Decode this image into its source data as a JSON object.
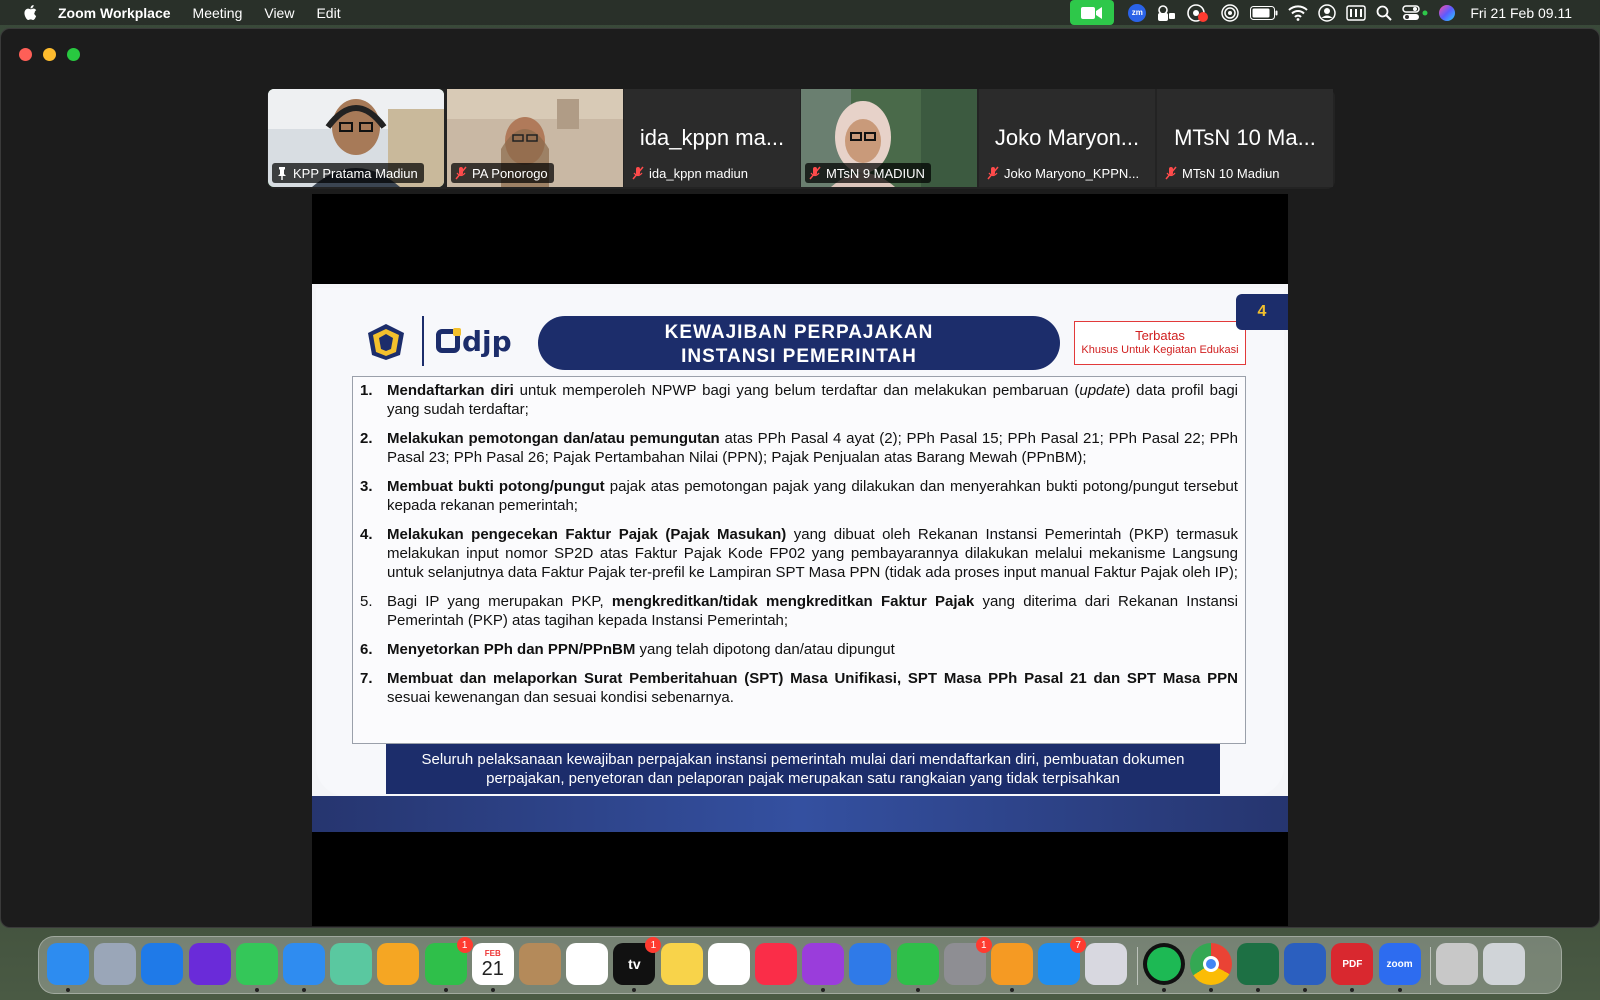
{
  "menubar": {
    "app_name": "Zoom Workplace",
    "menus": [
      "Meeting",
      "View",
      "Edit"
    ],
    "status_icons": [
      "zoom-video-icon",
      "zm-icon",
      "lock-status-icon",
      "screen-record-icon",
      "airplay-icon",
      "battery-icon",
      "wifi-icon",
      "user-icon",
      "keyboard-icon",
      "search-icon",
      "control-center-icon",
      "siri-icon"
    ],
    "zm_text": "zm",
    "clock": "Fri 21 Feb  09.11",
    "accent_color": "#2ec84a"
  },
  "participants": [
    {
      "name": "KPP Pratama Madiun",
      "big_name": "",
      "has_video": true,
      "active_speaker": true,
      "muted": false
    },
    {
      "name": "PA Ponorogo",
      "big_name": "",
      "has_video": true,
      "active_speaker": false,
      "muted": true
    },
    {
      "name": "ida_kppn madiun",
      "big_name": "ida_kppn ma...",
      "has_video": false,
      "active_speaker": false,
      "muted": true
    },
    {
      "name": "MTsN 9 MADIUN",
      "big_name": "",
      "has_video": true,
      "active_speaker": false,
      "muted": true
    },
    {
      "name": "Joko Maryono_KPPN...",
      "big_name": "Joko Maryon...",
      "has_video": false,
      "active_speaker": false,
      "muted": true
    },
    {
      "name": "MTsN 10 Madiun",
      "big_name": "MTsN 10 Ma...",
      "has_video": false,
      "active_speaker": false,
      "muted": true
    }
  ],
  "slide": {
    "page_number": "4",
    "logo_text": "djp",
    "title_line1": "KEWAJIBAN PERPAJAKAN",
    "title_line2": "INSTANSI PEMERINTAH",
    "restricted_label": "Terbatas",
    "restricted_sub": "Khusus Untuk Kegiatan Edukasi",
    "items": [
      {
        "num": "1.",
        "bold": "Mendaftarkan diri",
        "rest": " untuk memperoleh NPWP bagi yang belum terdaftar dan melakukan pembaruan (",
        "italic": "update",
        "rest2": ") data profil bagi yang sudah terdaftar;"
      },
      {
        "num": "2.",
        "bold": "Melakukan pemotongan dan/atau pemungutan",
        "rest": " atas PPh Pasal 4 ayat (2); PPh Pasal 15; PPh  Pasal 21; PPh  Pasal 22; PPh Pasal 23; PPh Pasal 26; Pajak Pertambahan Nilai (PPN); Pajak Penjualan atas Barang Mewah (PPnBM);"
      },
      {
        "num": "3.",
        "bold": "Membuat bukti potong/pungut",
        "rest": " pajak atas pemotongan pajak yang dilakukan dan menyerahkan bukti potong/pungut tersebut kepada rekanan pemerintah;"
      },
      {
        "num": "4.",
        "bold": "Melakukan pengecekan Faktur Pajak (Pajak Masukan)",
        "rest": " yang dibuat oleh Rekanan Instansi  Pemerintah  (PKP) termasuk melakukan input nomor SP2D atas Faktur Pajak Kode FP02 yang pembayarannya dilakukan  melalui mekanisme Langsung untuk selanjutnya data Faktur Pajak ter-prefil ke Lampiran SPT Masa PPN (tidak ada proses input manual Faktur Pajak oleh IP);"
      },
      {
        "num": "5.",
        "pre": "Bagi IP yang merupakan PKP, ",
        "bold": "mengkreditkan/tidak mengkreditkan Faktur Pajak",
        "rest": " yang diterima dari Rekanan Instansi Pemerintah (PKP) atas tagihan kepada Instansi Pemerintah;"
      },
      {
        "num": "6.",
        "bold": "Menyetorkan PPh dan PPN/PPnBM",
        "rest": " yang telah dipotong dan/atau dipungut"
      },
      {
        "num": "7.",
        "bold": "Membuat dan melaporkan Surat Pemberitahuan (SPT) Masa Unifikasi, SPT Masa PPh Pasal 21 dan SPT  Masa PPN",
        "rest": " sesuai kewenangan dan sesuai kondisi sebenarnya."
      }
    ],
    "summary": "Seluruh pelaksanaan kewajiban perpajakan instansi pemerintah mulai dari mendaftarkan diri, pembuatan dokumen perpajakan, penyetoran dan pelaporan pajak merupakan satu rangkaian yang tidak terpisahkan"
  },
  "dock": {
    "apps": [
      {
        "name": "finder-icon",
        "color": "#2d8cf0",
        "badge": ""
      },
      {
        "name": "launchpad-icon",
        "color": "#9aa6b8",
        "badge": ""
      },
      {
        "name": "safari-icon",
        "color": "#1f7ae8",
        "badge": ""
      },
      {
        "name": "firefox-icon",
        "color": "#6a2bd9",
        "badge": ""
      },
      {
        "name": "messages-icon",
        "color": "#34c759",
        "badge": ""
      },
      {
        "name": "mail-icon",
        "color": "#2f8cf0",
        "badge": ""
      },
      {
        "name": "maps-icon",
        "color": "#5ac8a0",
        "badge": ""
      },
      {
        "name": "photos-icon",
        "color": "#f5a623",
        "badge": ""
      },
      {
        "name": "facetime-icon",
        "color": "#2fbf4a",
        "badge": "1"
      },
      {
        "name": "calendar-icon",
        "color": "#ffffff",
        "badge": ""
      },
      {
        "name": "contacts-icon",
        "color": "#b48a5a",
        "badge": ""
      },
      {
        "name": "reminders-icon",
        "color": "#ffffff",
        "badge": ""
      },
      {
        "name": "apple-tv-icon",
        "color": "#111111",
        "badge": "1"
      },
      {
        "name": "notes-icon",
        "color": "#f8d34a",
        "badge": ""
      },
      {
        "name": "freeform-icon",
        "color": "#ffffff",
        "badge": ""
      },
      {
        "name": "music-icon",
        "color": "#fa2d48",
        "badge": ""
      },
      {
        "name": "podcasts-icon",
        "color": "#9a3ddb",
        "badge": ""
      },
      {
        "name": "keynote-icon",
        "color": "#2f7ae8",
        "badge": ""
      },
      {
        "name": "numbers-icon",
        "color": "#2fbf4a",
        "badge": ""
      },
      {
        "name": "system-settings-icon",
        "color": "#8e8e93",
        "badge": "1"
      },
      {
        "name": "pages-icon",
        "color": "#f59a23",
        "badge": ""
      },
      {
        "name": "app-store-icon",
        "color": "#1f8ef0",
        "badge": "7"
      },
      {
        "name": "iphone-mirroring-icon",
        "color": "#d8d8e0",
        "badge": ""
      },
      {
        "name": "spotify-icon",
        "color": "#1db954",
        "badge": ""
      },
      {
        "name": "chrome-icon",
        "color": "#ffffff",
        "badge": ""
      },
      {
        "name": "excel-icon",
        "color": "#1d7044",
        "badge": ""
      },
      {
        "name": "word-icon",
        "color": "#2b5fbf",
        "badge": ""
      },
      {
        "name": "pdf-icon",
        "color": "#d9282f",
        "badge": ""
      },
      {
        "name": "zoom-icon",
        "color": "#2d6cf0",
        "badge": ""
      },
      {
        "name": "downloads-stack-icon",
        "color": "#c8c8c8",
        "badge": ""
      },
      {
        "name": "trash-icon",
        "color": "#d0d4d8",
        "badge": ""
      }
    ],
    "calendar_month": "FEB",
    "calendar_day": "21",
    "tv_label": "tv",
    "zoom_label": "zoom",
    "pdf_label": "PDF"
  }
}
